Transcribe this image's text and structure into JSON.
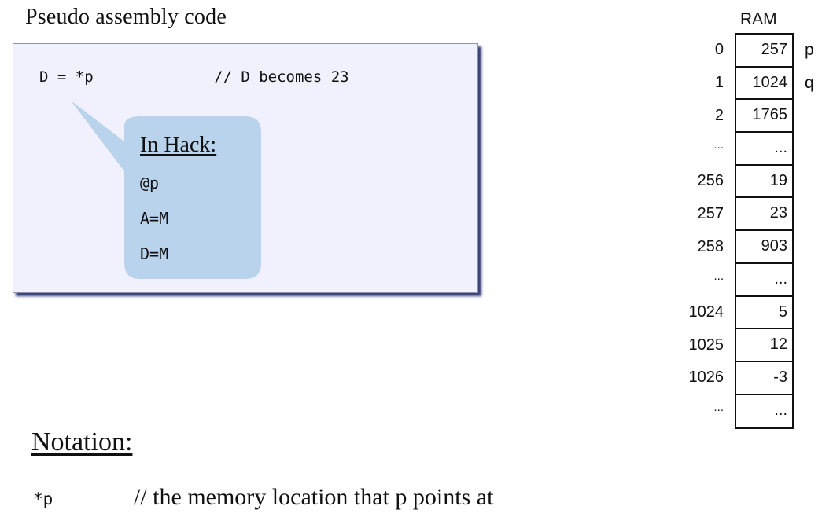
{
  "heading": "Pseudo assembly code",
  "code": {
    "statement": "D = *p",
    "comment": "// D becomes 23"
  },
  "callout": {
    "title": "In Hack:",
    "lines": [
      "@p",
      "A=M",
      "D=M"
    ]
  },
  "ram": {
    "title": "RAM",
    "rows": [
      {
        "addr": "0",
        "value": "257",
        "pointer": "p"
      },
      {
        "addr": "1",
        "value": "1024",
        "pointer": "q"
      },
      {
        "addr": "2",
        "value": "1765",
        "pointer": ""
      },
      {
        "addr": "...",
        "value": "...",
        "pointer": ""
      },
      {
        "addr": "256",
        "value": "19",
        "pointer": ""
      },
      {
        "addr": "257",
        "value": "23",
        "pointer": ""
      },
      {
        "addr": "258",
        "value": "903",
        "pointer": ""
      },
      {
        "addr": "...",
        "value": "...",
        "pointer": ""
      },
      {
        "addr": "1024",
        "value": "5",
        "pointer": ""
      },
      {
        "addr": "1025",
        "value": "12",
        "pointer": ""
      },
      {
        "addr": "1026",
        "value": "-3",
        "pointer": ""
      },
      {
        "addr": "...",
        "value": "...",
        "pointer": ""
      }
    ]
  },
  "notation": {
    "title": "Notation:",
    "symbol": "*p",
    "description": "// the memory location that p points at"
  },
  "colors": {
    "box_fill": "#f1f1fd",
    "box_shadow": "#3a3f7a",
    "callout_fill": "#bad3ec"
  }
}
